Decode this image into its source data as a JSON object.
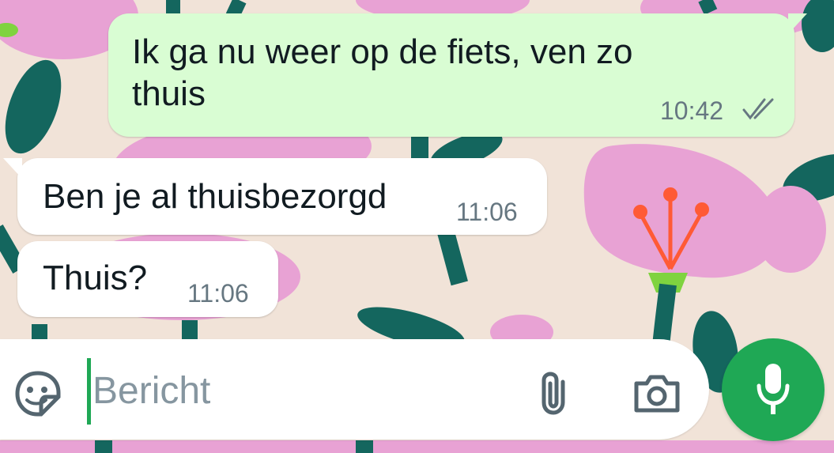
{
  "messages": [
    {
      "text": "Ik ga nu weer op de fiets, ven zo",
      "text2": "thuis",
      "time": "10:42",
      "status": "read-double-check"
    },
    {
      "text": "Ben je al thuisbezorgd",
      "time": "11:06"
    },
    {
      "text": "Thuis?",
      "time": "11:06"
    }
  ],
  "composer": {
    "placeholder": "Bericht",
    "icons": [
      "sticker-icon",
      "attach-icon",
      "camera-icon",
      "mic-icon"
    ]
  },
  "colors": {
    "background": "#f1e3d8",
    "outgoing_bubble": "#d9fdd3",
    "incoming_bubble": "#ffffff",
    "accent": "#1fa855",
    "time_text": "#667781"
  }
}
